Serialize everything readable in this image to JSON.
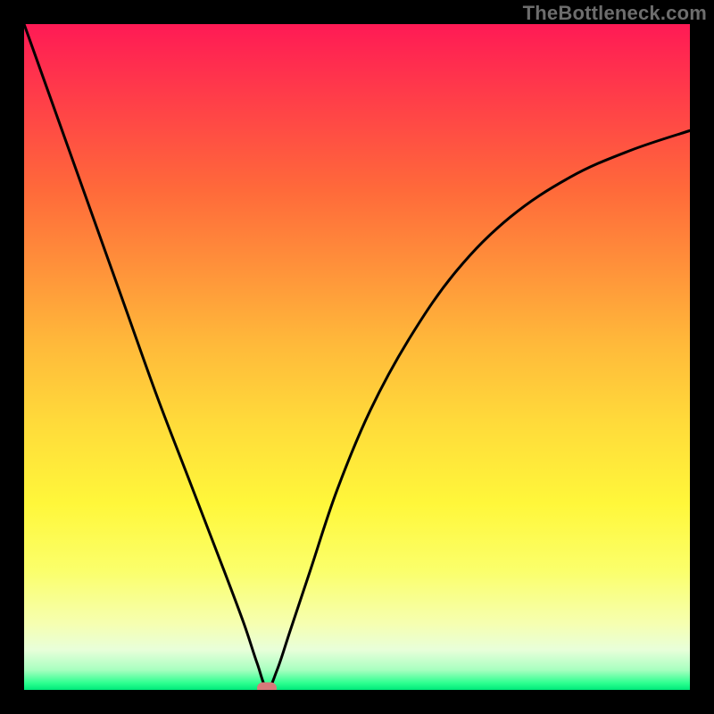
{
  "watermark": "TheBottleneck.com",
  "chart_data": {
    "type": "line",
    "title": "",
    "xlabel": "",
    "ylabel": "",
    "xlim": [
      0,
      100
    ],
    "ylim": [
      0,
      100
    ],
    "series": [
      {
        "name": "bottleneck-curve",
        "x": [
          0,
          5,
          10,
          15,
          20,
          25,
          30,
          33,
          35,
          36.5,
          38,
          40,
          43,
          47,
          52,
          58,
          65,
          73,
          82,
          91,
          100
        ],
        "values": [
          100,
          86,
          72,
          58,
          44,
          31,
          18,
          10,
          4,
          0.2,
          3,
          9,
          18,
          30,
          42,
          53,
          63,
          71,
          77,
          81,
          84
        ]
      }
    ],
    "marker": {
      "x": 36.5,
      "y": 0.3
    },
    "colors": {
      "curve": "#000000",
      "marker": "#d77a7a",
      "gradient_top": "#ff1a55",
      "gradient_bottom": "#00e87a"
    }
  }
}
